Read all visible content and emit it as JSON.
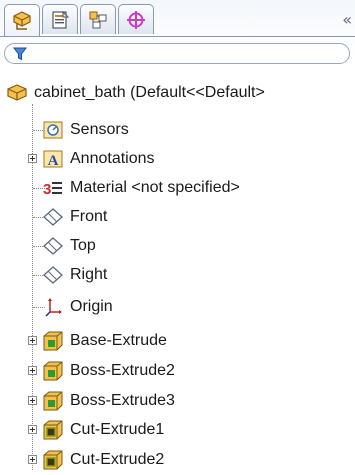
{
  "tabs": [
    {
      "name": "featuremanager-design-tree",
      "icon": "feature-tree-icon"
    },
    {
      "name": "propertymanager",
      "icon": "property-manager-icon"
    },
    {
      "name": "configurationmanager",
      "icon": "configuration-manager-icon"
    },
    {
      "name": "dimxpertmanager",
      "icon": "dimxpert-icon"
    }
  ],
  "collapse_label": "«",
  "filter": {
    "icon": "funnel-filter-icon",
    "value": ""
  },
  "root": {
    "label": "cabinet_bath  (Default<<Default>",
    "icon": "part-icon"
  },
  "items": [
    {
      "label": "Sensors",
      "icon": "sensors-icon",
      "expandable": false
    },
    {
      "label": "Annotations",
      "icon": "annotations-icon",
      "expandable": true
    },
    {
      "label": "Material <not specified>",
      "icon": "material-icon",
      "expandable": false
    },
    {
      "label": "Front",
      "icon": "plane-icon",
      "expandable": false
    },
    {
      "label": "Top",
      "icon": "plane-icon",
      "expandable": false
    },
    {
      "label": "Right",
      "icon": "plane-icon",
      "expandable": false
    },
    {
      "label": "Origin",
      "icon": "origin-icon",
      "expandable": false
    },
    {
      "label": "Base-Extrude",
      "icon": "boss-extrude-icon",
      "expandable": true
    },
    {
      "label": "Boss-Extrude2",
      "icon": "boss-extrude-icon",
      "expandable": true
    },
    {
      "label": "Boss-Extrude3",
      "icon": "boss-extrude-icon",
      "expandable": true
    },
    {
      "label": "Cut-Extrude1",
      "icon": "cut-extrude-icon",
      "expandable": true
    },
    {
      "label": "Cut-Extrude2",
      "icon": "cut-extrude-icon",
      "expandable": true
    }
  ],
  "colors": {
    "accent": "#c58a1c",
    "plane": "#5a6b80",
    "boss_green": "#2f9a2f",
    "cut_olive": "#8a9a1a"
  }
}
